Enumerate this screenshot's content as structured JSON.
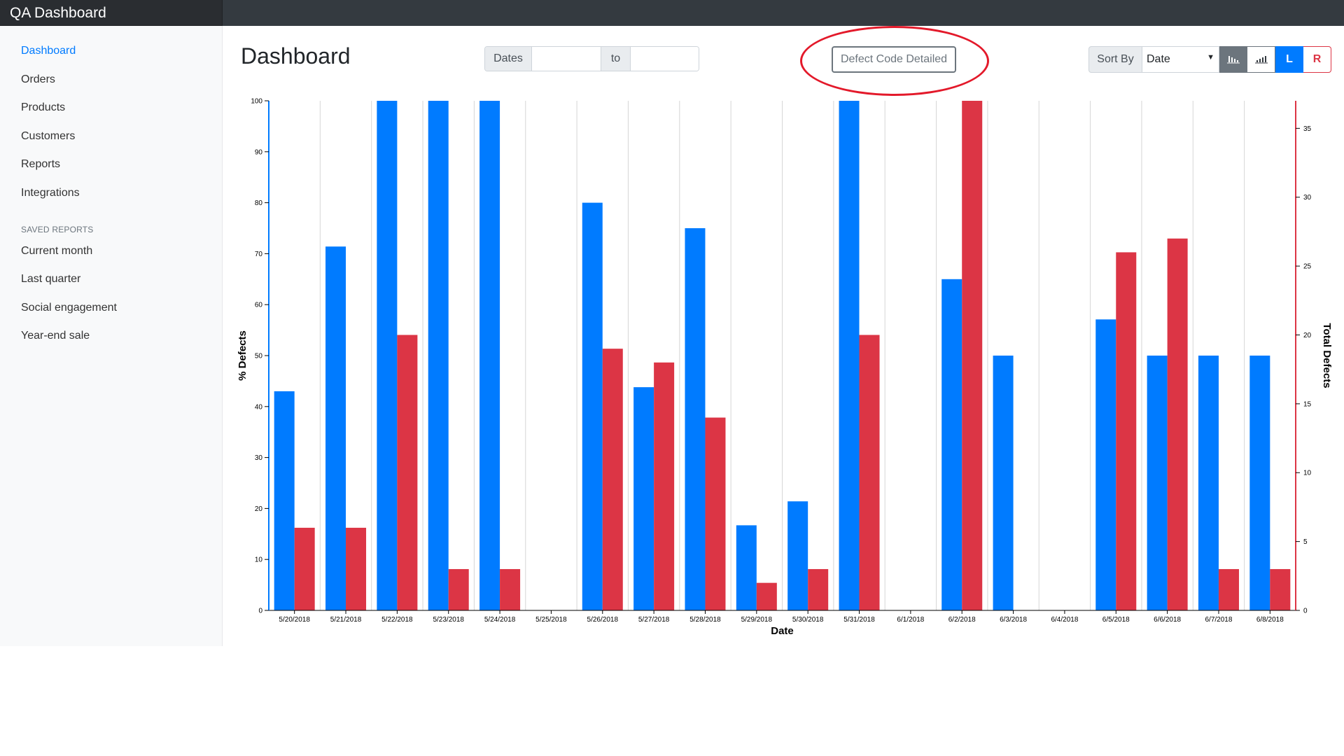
{
  "app": {
    "title": "QA Dashboard"
  },
  "sidebar": {
    "items": [
      {
        "label": "Dashboard",
        "active": true
      },
      {
        "label": "Orders"
      },
      {
        "label": "Products"
      },
      {
        "label": "Customers"
      },
      {
        "label": "Reports"
      },
      {
        "label": "Integrations"
      }
    ],
    "saved_heading": "SAVED REPORTS",
    "saved": [
      {
        "label": "Current month"
      },
      {
        "label": "Last quarter"
      },
      {
        "label": "Social engagement"
      },
      {
        "label": "Year-end sale"
      }
    ]
  },
  "main": {
    "title": "Dashboard",
    "dates_label": "Dates",
    "to_label": "to",
    "date_from": "",
    "date_to": "",
    "defect_button": "Defect Code Detailed",
    "sort_label": "Sort By",
    "sort_value": "Date",
    "left_button": "L",
    "right_button": "R",
    "toolbar_icons": [
      "sort-descending-bars-icon",
      "sort-ascending-bars-icon"
    ]
  },
  "colors": {
    "blue": "#007bff",
    "red": "#dc3545",
    "annotation": "#e3192a"
  },
  "chart_data": {
    "type": "bar",
    "xlabel": "Date",
    "ylabel": "% Defects",
    "y2label": "Total Defects",
    "ylim": [
      0,
      100
    ],
    "y2lim": [
      0,
      37
    ],
    "yticks": [
      0,
      10,
      20,
      30,
      40,
      50,
      60,
      70,
      80,
      90,
      100
    ],
    "y2ticks": [
      0,
      5,
      10,
      15,
      20,
      25,
      30,
      35
    ],
    "categories": [
      "5/20/2018",
      "5/21/2018",
      "5/22/2018",
      "5/23/2018",
      "5/24/2018",
      "5/25/2018",
      "5/26/2018",
      "5/27/2018",
      "5/28/2018",
      "5/29/2018",
      "5/30/2018",
      "5/31/2018",
      "6/1/2018",
      "6/2/2018",
      "6/3/2018",
      "6/4/2018",
      "6/5/2018",
      "6/6/2018",
      "6/7/2018",
      "6/8/2018"
    ],
    "series": [
      {
        "axis": "left",
        "color": "#007bff",
        "values": [
          43,
          71.4,
          100,
          100,
          100,
          0,
          80,
          43.8,
          75,
          16.7,
          21.4,
          100,
          0,
          65,
          50,
          0,
          57.1,
          50,
          50,
          50
        ]
      },
      {
        "axis": "right",
        "color": "#dc3545",
        "values": [
          6,
          6,
          20,
          3,
          3,
          0,
          19,
          18,
          14,
          2,
          3,
          20,
          0,
          37,
          0,
          0,
          26,
          27,
          3,
          3
        ]
      }
    ],
    "grid": "vertical"
  }
}
